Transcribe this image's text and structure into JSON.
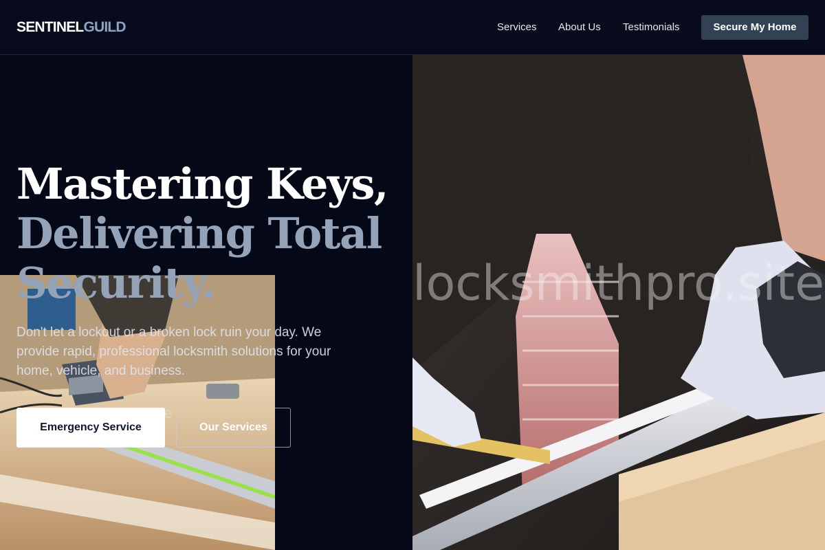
{
  "brand": {
    "part1": "SENTINEL",
    "part2": "GUILD"
  },
  "nav": {
    "items": [
      "Services",
      "About Us",
      "Testimonials"
    ],
    "cta": "Secure My Home"
  },
  "hero": {
    "headline_line1": "Mastering Keys,",
    "headline_line2": "Delivering Total",
    "headline_line3": "Security.",
    "subtext": "Don't let a lockout or a broken lock ruin your day. We provide rapid, professional locksmith solutions for your home, vehicle, and business.",
    "primary_button": "Emergency Service",
    "secondary_button": "Our Services"
  },
  "watermark": {
    "large": "locksmithpro.site",
    "small": ".site"
  },
  "colors": {
    "background": "#050816",
    "accent": "#334155",
    "headline_secondary": "#94a3b8"
  }
}
